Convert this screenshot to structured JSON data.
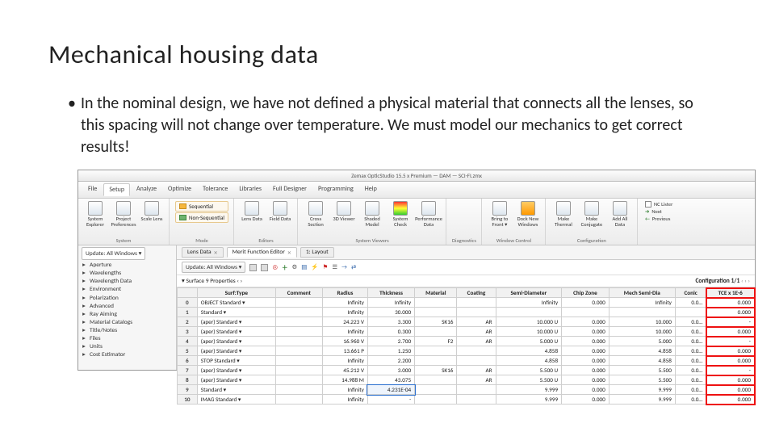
{
  "slide": {
    "title": "Mechanical housing data",
    "bullet": "In the nominal design, we have not defined a physical material that connects all the lenses, so this spacing will not change over temperature. We must model our mechanics to get correct results!"
  },
  "window_title": "Zemax OpticStudio 15.5 x Premium — DAM — SCI-FI.zmx",
  "menus": [
    "File",
    "Setup",
    "Analyze",
    "Optimize",
    "Tolerance",
    "Libraries",
    "Full Designer",
    "Programming",
    "Help"
  ],
  "ribbon": {
    "system": {
      "label": "System",
      "buttons": [
        {
          "label": "System\nExplorer"
        },
        {
          "label": "Project\nPreferences"
        },
        {
          "label": "Scale\nLens"
        }
      ]
    },
    "mode": {
      "label": "Mode",
      "sequential": "Sequential",
      "nonsequential": "Non-Sequential"
    },
    "editors": {
      "label": "Editors",
      "buttons": [
        {
          "label": "Lens\nData"
        },
        {
          "label": "Field\nData"
        }
      ]
    },
    "system_viewers": {
      "label": "System Viewers",
      "buttons": [
        {
          "label": "Cross\nSection"
        },
        {
          "label": "3D\nViewer"
        },
        {
          "label": "Shaded\nModel"
        },
        {
          "label": "System\nCheck"
        },
        {
          "label": "Performance\nData"
        }
      ]
    },
    "diagnostics": {
      "label": "Diagnostics"
    },
    "window_control": {
      "label": "Window Control",
      "buttons": [
        {
          "label": "Bring to\nFront ▾"
        },
        {
          "label": "Dock New\nWindows"
        }
      ]
    },
    "configuration": {
      "label": "Configuration",
      "buttons": [
        {
          "label": "Make\nThermal"
        },
        {
          "label": "Make\nConjugate"
        },
        {
          "label": "Add All\nData"
        }
      ]
    },
    "side": {
      "nclister": "NC Lister",
      "next": "Next",
      "previous": "Previous"
    }
  },
  "sidebar": {
    "update_label": "Update: All Windows ▾",
    "items": [
      "Aperture",
      "Wavelengths",
      "Wavelength Data",
      "Environment",
      "Polarization",
      "Advanced",
      "Ray Aiming",
      "Material Catalogs",
      "Title/Notes",
      "Files",
      "Units",
      "Cost Estimator"
    ]
  },
  "editor": {
    "tabs": [
      {
        "label": "Lens Data"
      },
      {
        "label": "Merit Function Editor"
      },
      {
        "label": "1: Layout"
      }
    ],
    "toolbar_label": "Update: All Windows ▾",
    "breadcrumb": "▾ Surface 9 Properties ‹ ›",
    "config_label": "Configuration 1/1",
    "columns": [
      "",
      "Surf:Type",
      "Comment",
      "Radius",
      "Thickness",
      "Material",
      "Coating",
      "Semi-Diameter",
      "Chip Zone",
      "Mech Semi-Dia",
      "Conic",
      "TCE x 1E-6"
    ],
    "rows": [
      {
        "n": "0",
        "type": "OBJECT Standard ▾",
        "comment": "",
        "radius": "Infinity",
        "thick": "Infinity",
        "mat": "",
        "coat": "",
        "semi": "Infinity",
        "chip": "0.000",
        "mech": "Infinity",
        "conic": "0.0…",
        "tce": "0.000"
      },
      {
        "n": "1",
        "type": "Standard ▾",
        "comment": "",
        "radius": "Infinity",
        "thick": "30.000",
        "mat": "",
        "coat": "",
        "semi": "",
        "chip": "",
        "mech": "",
        "conic": "",
        "tce": "0.000"
      },
      {
        "n": "2",
        "type": "(aper) Standard ▾",
        "comment": "",
        "radius": "24.223 V",
        "thick": "3.300",
        "mat": "SK16",
        "coat": "AR",
        "semi": "10.000 U",
        "chip": "0.000",
        "mech": "10.000",
        "conic": "0.0…",
        "tce": "-"
      },
      {
        "n": "3",
        "type": "(aper) Standard ▾",
        "comment": "",
        "radius": "Infinity",
        "thick": "0.300",
        "mat": "",
        "coat": "AR",
        "semi": "10.000 U",
        "chip": "0.000",
        "mech": "10.000",
        "conic": "0.0…",
        "tce": "0.000"
      },
      {
        "n": "4",
        "type": "(aper) Standard ▾",
        "comment": "",
        "radius": "16.960 V",
        "thick": "2.700",
        "mat": "F2",
        "coat": "AR",
        "semi": "5.000 U",
        "chip": "0.000",
        "mech": "5.000",
        "conic": "0.0…",
        "tce": "-"
      },
      {
        "n": "5",
        "type": "(aper) Standard ▾",
        "comment": "",
        "radius": "13.661 P",
        "thick": "1.250",
        "mat": "",
        "coat": "",
        "semi": "4.858",
        "chip": "0.000",
        "mech": "4.858",
        "conic": "0.0…",
        "tce": "0.000"
      },
      {
        "n": "6",
        "type": "STOP Standard ▾",
        "comment": "",
        "radius": "Infinity",
        "thick": "2.200",
        "mat": "",
        "coat": "",
        "semi": "4.858",
        "chip": "0.000",
        "mech": "4.858",
        "conic": "0.0…",
        "tce": "0.000"
      },
      {
        "n": "7",
        "type": "(aper) Standard ▾",
        "comment": "",
        "radius": "45.212 V",
        "thick": "3.000",
        "mat": "SK16",
        "coat": "AR",
        "semi": "5.500 U",
        "chip": "0.000",
        "mech": "5.500",
        "conic": "0.0…",
        "tce": "-"
      },
      {
        "n": "8",
        "type": "(aper) Standard ▾",
        "comment": "",
        "radius": "14.988 M",
        "thick": "43.075",
        "mat": "",
        "coat": "AR",
        "semi": "5.500 U",
        "chip": "0.000",
        "mech": "5.500",
        "conic": "0.0…",
        "tce": "0.000"
      },
      {
        "n": "9",
        "type": "Standard ▾",
        "comment": "",
        "radius": "Infinity",
        "thick": "4.231E-04",
        "mat": "",
        "coat": "",
        "semi": "9.999",
        "chip": "0.000",
        "mech": "9.999",
        "conic": "0.0…",
        "tce": "0.000"
      },
      {
        "n": "10",
        "type": "IMAG Standard ▾",
        "comment": "",
        "radius": "Infinity",
        "thick": "-",
        "mat": "",
        "coat": "",
        "semi": "9.999",
        "chip": "0.000",
        "mech": "9.999",
        "conic": "0.0…",
        "tce": "0.000"
      }
    ],
    "edit_row_index": 9,
    "edit_col": "thick"
  }
}
